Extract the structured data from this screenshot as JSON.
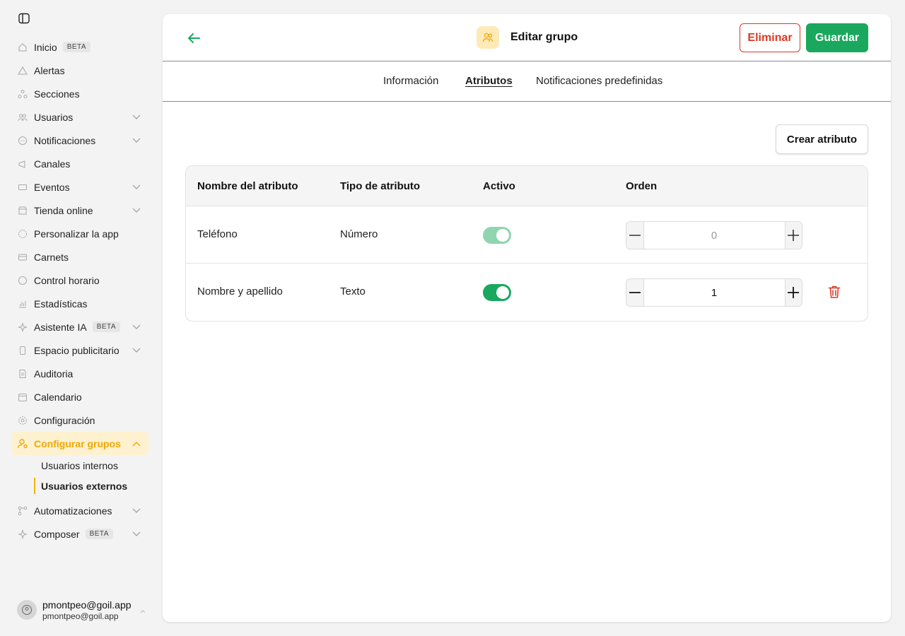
{
  "sidebar": {
    "items": [
      {
        "label": "Inicio",
        "badge": "BETA"
      },
      {
        "label": "Alertas"
      },
      {
        "label": "Secciones"
      },
      {
        "label": "Usuarios"
      },
      {
        "label": "Notificaciones"
      },
      {
        "label": "Canales"
      },
      {
        "label": "Eventos"
      },
      {
        "label": "Tienda online"
      },
      {
        "label": "Personalizar la app"
      },
      {
        "label": "Carnets"
      },
      {
        "label": "Control horario"
      },
      {
        "label": "Estadísticas"
      },
      {
        "label": "Asistente IA",
        "badge": "BETA"
      },
      {
        "label": "Espacio publicitario"
      },
      {
        "label": "Auditoria"
      },
      {
        "label": "Calendario"
      },
      {
        "label": "Configuración"
      },
      {
        "label": "Configurar grupos"
      },
      {
        "label": "Automatizaciones"
      },
      {
        "label": "Composer",
        "badge": "BETA"
      }
    ],
    "subitems": [
      {
        "label": "Usuarios internos"
      },
      {
        "label": "Usuarios externos"
      }
    ],
    "user": {
      "name": "pmontpeo@goil.app",
      "email": "pmontpeo@goil.app"
    }
  },
  "header": {
    "title": "Editar grupo",
    "delete_label": "Eliminar",
    "save_label": "Guardar"
  },
  "tabs": [
    {
      "label": "Información"
    },
    {
      "label": "Atributos"
    },
    {
      "label": "Notificaciones predefinidas"
    }
  ],
  "create_attribute_label": "Crear atributo",
  "table": {
    "columns": [
      "Nombre del atributo",
      "Tipo de atributo",
      "Activo",
      "Orden"
    ],
    "rows": [
      {
        "name": "Teléfono",
        "type": "Número",
        "active": true,
        "order": "0"
      },
      {
        "name": "Nombre y apellido",
        "type": "Texto",
        "active": true,
        "order": "1"
      }
    ]
  },
  "colors": {
    "accent": "#19a85d",
    "danger": "#d93a26",
    "active_nav": "#f2a800"
  }
}
